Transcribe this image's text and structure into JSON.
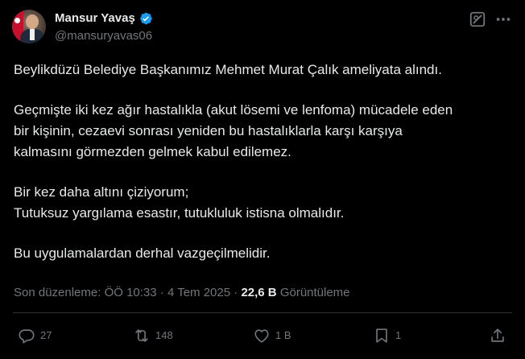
{
  "tweet": {
    "author": {
      "display_name": "Mansur Yavaş",
      "handle": "@mansuryavas06",
      "verified": true
    },
    "body": {
      "p1": "Beylikdüzü Belediye Başkanımız Mehmet Murat Çalık ameliyata alındı.",
      "p2_line1": "Geçmişte iki kez ağır hastalıkla (akut lösemi ve lenfoma) mücadele eden",
      "p2_line2": "bir kişinin, cezaevi sonrası yeniden bu hastalıklarla karşı karşıya",
      "p2_line3": "kalmasını görmezden gelmek kabul edilemez.",
      "p3_line1": "Bir kez daha altını çiziyorum;",
      "p3_line2": "Tutuksuz yargılama esastır, tutukluluk istisna olmalıdır.",
      "p4": "Bu uygulamalardan derhal vazgeçilmelidir."
    },
    "meta": {
      "edited_label": "Son düzenleme: ÖÖ 10:33",
      "separator": "·",
      "date": "4 Tem 2025",
      "views_count": "22,6 B",
      "views_label": "Görüntüleme"
    },
    "actions": {
      "replies": "27",
      "reposts": "148",
      "likes": "1 B",
      "bookmarks": "1"
    }
  },
  "icons": {
    "reply": "reply-icon",
    "repost": "repost-icon",
    "like": "heart-icon",
    "bookmark": "bookmark-icon",
    "share": "share-icon",
    "grok": "grok-icon",
    "more": "more-icon",
    "verified": "verified-badge-icon"
  },
  "colors": {
    "background": "#000000",
    "text": "#e7e9ea",
    "secondary": "#71767b",
    "verified": "#1d9bf0",
    "divider": "#2f3336"
  }
}
